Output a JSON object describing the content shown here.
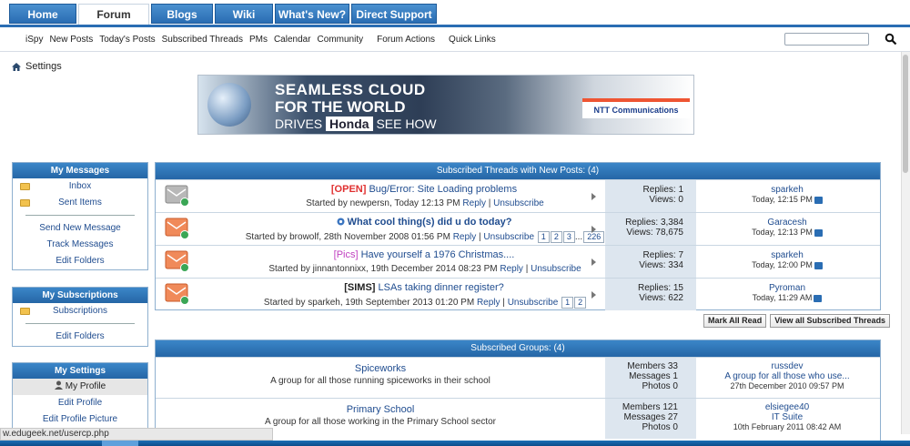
{
  "topnav": {
    "tabs": [
      "Home",
      "Forum",
      "Blogs",
      "Wiki",
      "What's New?",
      "Direct Support"
    ],
    "active": 1
  },
  "subnav": {
    "links": [
      "iSpy",
      "New Posts",
      "Today's Posts",
      "Subscribed Threads",
      "PMs",
      "Calendar",
      "Community"
    ],
    "right_links": [
      "Forum Actions",
      "Quick Links"
    ],
    "search_placeholder": ""
  },
  "breadcrumb": "Settings",
  "banner": {
    "line1": "SEAMLESS CLOUD",
    "line2": "FOR THE WORLD",
    "line3a": "DRIVES",
    "brand": "Honda",
    "cta": "SEE HOW",
    "partner": "NTT Communications"
  },
  "sidebar": {
    "messages": {
      "title": "My Messages",
      "items": [
        "Inbox",
        "Sent Items"
      ],
      "actions": [
        "Send New Message",
        "Track Messages",
        "Edit Folders"
      ]
    },
    "subscriptions": {
      "title": "My Subscriptions",
      "items": [
        "Subscriptions"
      ],
      "actions": [
        "Edit Folders"
      ]
    },
    "settings": {
      "title": "My Settings",
      "items": [
        "My Profile",
        "Edit Profile",
        "Edit Profile Picture"
      ]
    }
  },
  "threads": {
    "title": "Subscribed Threads with New Posts: (4)",
    "rows": [
      {
        "prefix": "[OPEN]",
        "prefix_type": "open",
        "rest_prefix": " Bug/Error:",
        "title": " Site Loading problems",
        "started": "Started by newpersn, Today 12:13 PM",
        "reply": "Reply",
        "unsub": "Unsubscribe",
        "pages": [],
        "replies": "Replies: 1",
        "views": "Views: 0",
        "last_user": "sparkeh",
        "last_time": "Today, 12:15 PM",
        "icon_style": "grey"
      },
      {
        "prefix": "",
        "prefix_type": "",
        "rest_prefix": "",
        "title": "What cool thing(s) did u do today?",
        "started": "Started by browolf, 28th November 2008 01:56 PM",
        "reply": "Reply",
        "unsub": "Unsubscribe",
        "pages": [
          "1",
          "2",
          "3",
          "...",
          "226"
        ],
        "replies": "Replies: 3,384",
        "views": "Views: 78,675",
        "last_user": "Garacesh",
        "last_time": "Today, 12:13 PM",
        "icon_style": "orange"
      },
      {
        "prefix": "[Pics]",
        "prefix_type": "pics",
        "rest_prefix": "",
        "title": " Have yourself a 1976 Christmas....",
        "started": "Started by jinnantonnixx, 19th December 2014 08:23 PM",
        "reply": "Reply",
        "unsub": "Unsubscribe",
        "pages": [],
        "replies": "Replies: 7",
        "views": "Views: 334",
        "last_user": "sparkeh",
        "last_time": "Today, 12:00 PM",
        "icon_style": "orange"
      },
      {
        "prefix": "[SIMS]",
        "prefix_type": "sims",
        "rest_prefix": "",
        "title": " LSAs taking dinner register?",
        "started": "Started by sparkeh, 19th September 2013 01:20 PM",
        "reply": "Reply",
        "unsub": "Unsubscribe",
        "pages": [
          "1",
          "2"
        ],
        "replies": "Replies: 15",
        "views": "Views: 622",
        "last_user": "Pyroman",
        "last_time": "Today, 11:29 AM",
        "icon_style": "orange"
      }
    ],
    "mark_all": "Mark All Read",
    "view_all": "View all Subscribed Threads"
  },
  "groups": {
    "title": "Subscribed Groups: (4)",
    "rows": [
      {
        "name": "Spiceworks",
        "desc": "A group for all those running spiceworks in their school",
        "members": "Members 33",
        "messages": "Messages 1",
        "photos": "Photos 0",
        "last_user": "russdev",
        "last_title": "A group for all those who use...",
        "last_time": "27th December 2010 09:57 PM"
      },
      {
        "name": "Primary School",
        "desc": "A group for all those working in the Primary School sector",
        "members": "Members 121",
        "messages": "Messages 27",
        "photos": "Photos 0",
        "last_user": "elsiegee40",
        "last_title": "IT Suite",
        "last_time": "10th February 2011 08:42 AM"
      }
    ]
  },
  "status_url": "w.edugeek.net/usercp.php"
}
